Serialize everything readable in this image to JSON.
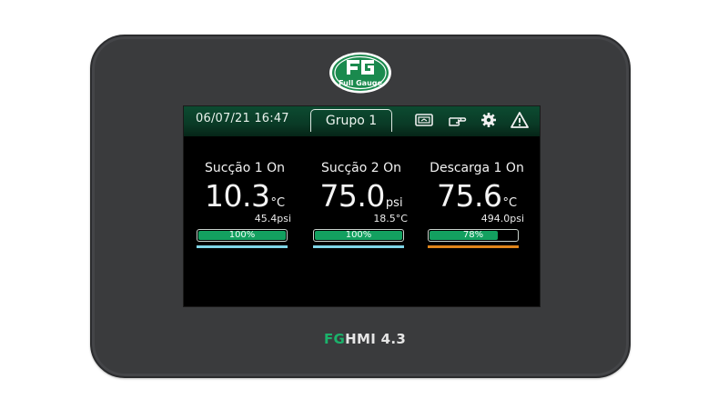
{
  "device": {
    "logo_text": "Full Gauge",
    "model_prefix": "FG",
    "model_name": "HMI 4.3"
  },
  "header": {
    "datetime": "06/07/21 16:47",
    "group_tab": "Grupo 1",
    "icons": [
      "screen-icon",
      "pointing-hand-icon",
      "gear-icon",
      "warning-icon"
    ]
  },
  "cards": [
    {
      "title": "Sucção 1 On",
      "value": "10.3",
      "unit": "°C",
      "secondary": "45.4psi",
      "percent": "100%",
      "level": 100,
      "line_color": "#7fd6e8"
    },
    {
      "title": "Sucção 2 On",
      "value": "75.0",
      "unit": "psi",
      "secondary": "18.5°C",
      "percent": "100%",
      "level": 100,
      "line_color": "#7fd6e8"
    },
    {
      "title": "Descarga 1 On",
      "value": "75.6",
      "unit": "°C",
      "secondary": "494.0psi",
      "percent": "78%",
      "level": 78,
      "line_color": "#e0851a"
    }
  ],
  "colors": {
    "accent": "#13a060",
    "header_green": "#0c4b31",
    "bezel": "#3a3b3d"
  }
}
